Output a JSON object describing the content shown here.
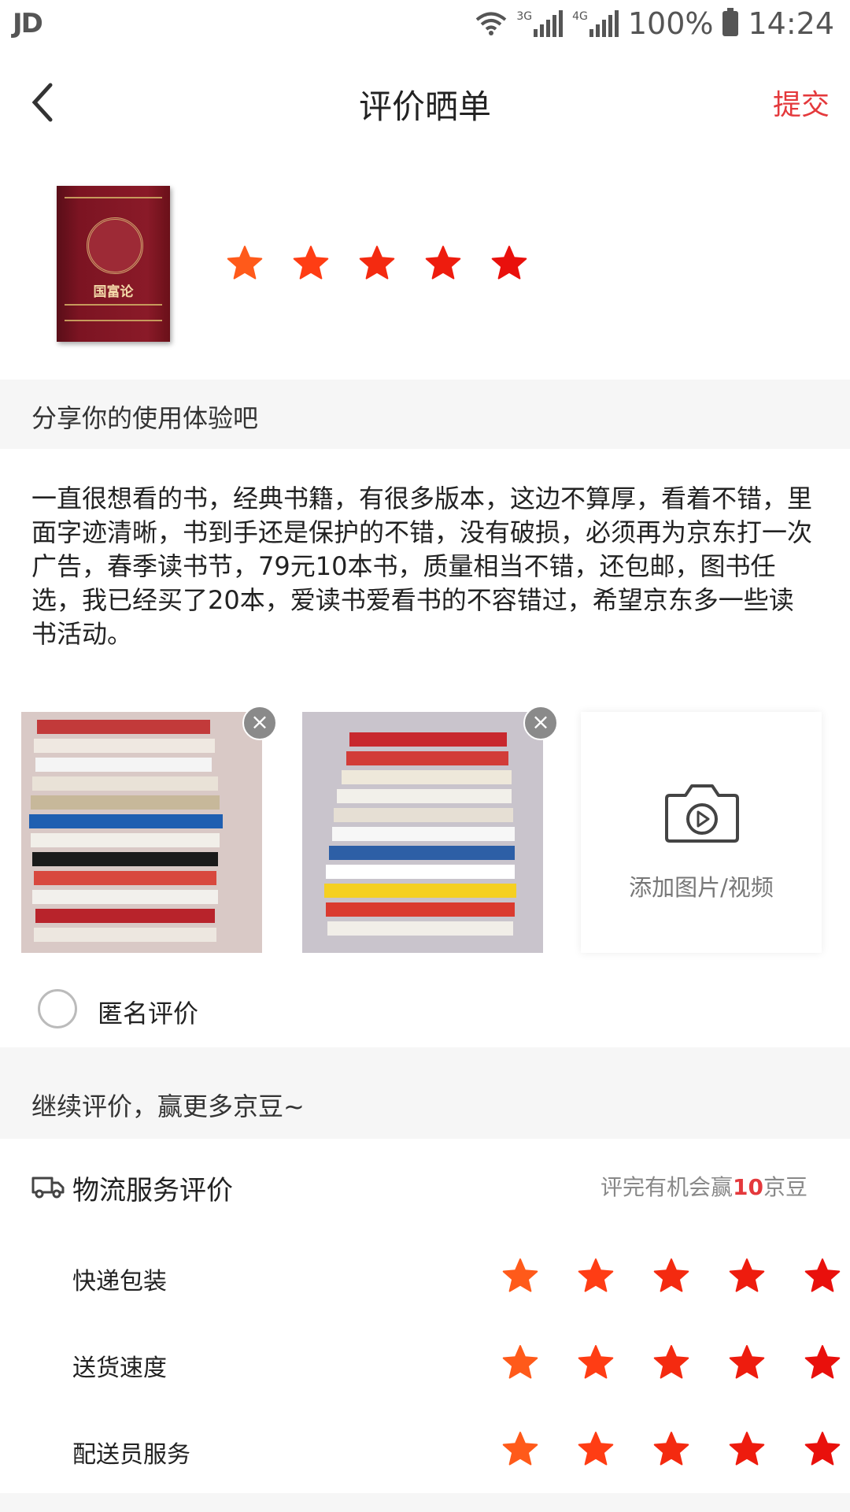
{
  "status_bar": {
    "carrier_logo": "JD",
    "signal_labels": [
      "3G",
      "4G"
    ],
    "battery": "100%",
    "time": "14:24"
  },
  "header": {
    "title": "评价晒单",
    "submit_label": "提交",
    "back_icon": "chevron-left-icon"
  },
  "product": {
    "cover_title": "国富论",
    "rating": 5,
    "max_rating": 5
  },
  "share_section": {
    "heading": "分享你的使用体验吧",
    "review_text": "一直很想看的书，经典书籍，有很多版本，这边不算厚，看着不错，里面字迹清晰，书到手还是保护的不错，没有破损，必须再为京东打一次广告，春季读书节，79元10本书，质量相当不错，还包邮，图书任选，我已经买了20本，爱读书爱看书的不容错过，希望京东多一些读书活动。"
  },
  "photos": {
    "count": 2,
    "add_label": "添加图片/视频",
    "add_icon": "camera-video-icon",
    "delete_icon": "close-icon"
  },
  "anonymous": {
    "label": "匿名评价",
    "checked": false
  },
  "continue_section": {
    "heading": "继续评价，赢更多京豆~"
  },
  "logistics": {
    "icon": "truck-icon",
    "title": "物流服务评价",
    "hint_prefix": "评完有机会赢",
    "hint_number": "10",
    "hint_suffix": "京豆",
    "rows": [
      {
        "label": "快递包装",
        "rating": 5
      },
      {
        "label": "送货速度",
        "rating": 5
      },
      {
        "label": "配送员服务",
        "rating": 5
      }
    ]
  },
  "colors": {
    "accent": "#e4393c",
    "star_gradient": [
      "#ff5a1a",
      "#ff3d14",
      "#f42a10",
      "#ee1c0e",
      "#e9100c"
    ]
  }
}
